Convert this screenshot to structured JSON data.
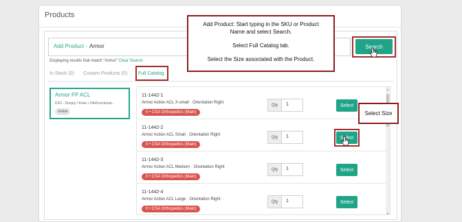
{
  "panel": {
    "title": "Products"
  },
  "search": {
    "label": "Add Product -",
    "value": "Armor",
    "button_label": "Search"
  },
  "results": {
    "text": "Displaying results that match \"Armor\"",
    "clear_label": "Clear Search"
  },
  "tabs": [
    {
      "label": "In Stock (0)",
      "active": false
    },
    {
      "label": "Custom Products (0)",
      "active": false
    },
    {
      "label": "Full Catalog",
      "active": true
    }
  ],
  "product_card": {
    "title": "Armor FP ACL",
    "subtitle": "DJO - Donjoy • Knee • OA/Functional...",
    "badge": "Global"
  },
  "rows": [
    {
      "sku": "11-1442-1",
      "description": "Armor Action ACL X-small · Orientation Right",
      "location": "0 • CSA Orthopedics (Main)",
      "qty_label": "Qty",
      "qty": "1",
      "select_label": "Select"
    },
    {
      "sku": "11-1442-2",
      "description": "Armor Action ACL Small · Orientation Right",
      "location": "0 • CSA Orthopedics (Main)",
      "qty_label": "Qty",
      "qty": "1",
      "select_label": "Select"
    },
    {
      "sku": "11-1442-3",
      "description": "Armor Action ACL Medium · Orientation Right",
      "location": "0 • CSA Orthopedics (Main)",
      "qty_label": "Qty",
      "qty": "1",
      "select_label": "Select"
    },
    {
      "sku": "11-1442-4",
      "description": "Armor Action ACL Large · Orientation Right",
      "location": "0 • CSA Orthopedics (Main)",
      "qty_label": "Qty",
      "qty": "1",
      "select_label": "Select"
    }
  ],
  "annotations": {
    "main_line1": "Add Product: Start typing in the SKU or Product",
    "main_line2": "Name and select Search.",
    "main_line3": "Select Full Catalog tab.",
    "main_line4": "Select the Size associated with the Product.",
    "size_callout": "Select Size"
  },
  "colors": {
    "accent": "#1fa487",
    "danger": "#d9534f",
    "highlight": "#a52a2a"
  }
}
